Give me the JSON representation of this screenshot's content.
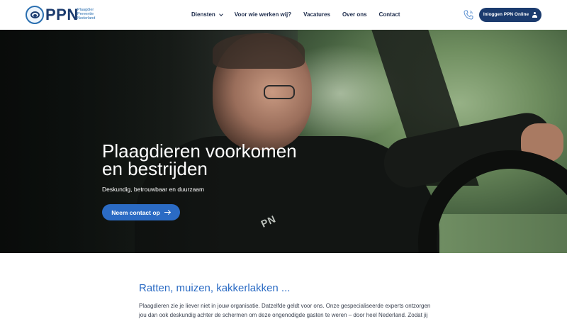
{
  "header": {
    "logo_text": "PPN",
    "logo_sub": [
      "Plaagdier",
      "Preventie",
      "Nederland"
    ],
    "nav": [
      {
        "label": "Diensten",
        "has_dropdown": true
      },
      {
        "label": "Voor wie werken wij?"
      },
      {
        "label": "Vacatures"
      },
      {
        "label": "Over ons"
      },
      {
        "label": "Contact"
      }
    ],
    "login_label": "Inloggen PPN Online"
  },
  "hero": {
    "title_line1": "Plaagdieren voorkomen",
    "title_line2": "en bestrijden",
    "subtitle": "Deskundig, betrouwbaar en duurzaam",
    "cta_label": "Neem contact op",
    "shirt_mark": "PN"
  },
  "content": {
    "title": "Ratten, muizen, kakkerlakken ...",
    "body_lines": [
      "Plaagdieren zie je liever niet in jouw organisatie. Datzelfde geldt voor ons. Onze gespecialiseerde experts ontzorgen",
      "jou dan ook deskundig achter de schermen om deze ongenodigde gasten te weren – door heel Nederland. Zodat jij"
    ]
  },
  "colors": {
    "brand_dark": "#1b3b6e",
    "accent_blue": "#2b6bc4"
  }
}
